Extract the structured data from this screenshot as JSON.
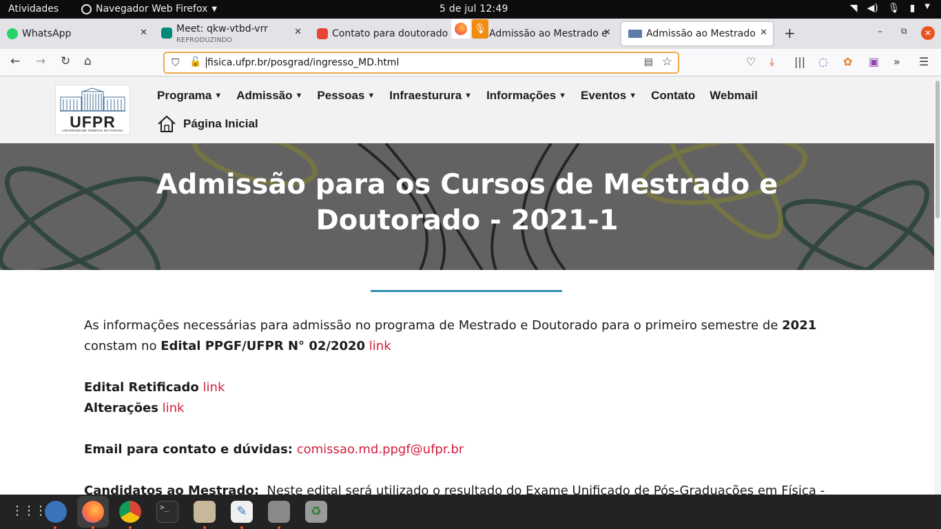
{
  "topbar": {
    "activities": "Atividades",
    "app_name": "Navegador Web Firefox",
    "clock": "5 de jul  12:49"
  },
  "tabs": [
    {
      "label": "WhatsApp",
      "favicon": "whatsapp-icon",
      "color": "#25d366"
    },
    {
      "label": "Meet: qkw-vtbd-vrr",
      "sublabel": "REPRODUZINDO",
      "favicon": "meet-icon",
      "color": "#00897b"
    },
    {
      "label": "Contato para doutorado -",
      "favicon": "gmail-icon",
      "color": "#ea4335"
    },
    {
      "label": "Admissão ao Mestrado e",
      "favicon": "ufpr-icon",
      "color": "#5b7da8"
    },
    {
      "label": "Admissão ao Mestrado e",
      "favicon": "ufpr-icon",
      "color": "#5b7da8",
      "active": true
    }
  ],
  "urlbar": {
    "url": "fisica.ufpr.br/posgrad/ingresso_MD.html"
  },
  "site": {
    "logo": {
      "name": "UFPR",
      "subtitle": "UNIVERSIDADE FEDERAL DO PARANÁ"
    },
    "nav": [
      {
        "label": "Programa",
        "dropdown": true
      },
      {
        "label": "Admissão",
        "dropdown": true
      },
      {
        "label": "Pessoas",
        "dropdown": true
      },
      {
        "label": "Infraesturura",
        "dropdown": true
      },
      {
        "label": "Informações",
        "dropdown": true
      },
      {
        "label": "Eventos",
        "dropdown": true
      },
      {
        "label": "Contato",
        "dropdown": false
      },
      {
        "label": "Webmail",
        "dropdown": false
      }
    ],
    "home_label": "Página Inicial"
  },
  "hero": {
    "title_line1": "Admissão para os Cursos de Mestrado e",
    "title_line2": "Doutorado - 2021-1"
  },
  "content": {
    "intro_a": "As informações necessárias para admissão no programa de Mestrado e Doutorado para o primeiro semestre de ",
    "intro_year": "2021",
    "intro_b": "constam no ",
    "edital_name": "Edital PPGF/UFPR N° 02/2020",
    "link_text": "link",
    "retificado_label": "Edital Retificado",
    "alteracoes_label": "Alterações",
    "email_label": "Email para contato e dúvidas:",
    "email": "comissao.md.ppgf@ufpr.br",
    "mestrado_label": "Candidatos ao Mestrado:",
    "mestrado_text": "Neste edital será utilizado o resultado do Exame Unificado de Pós-Graduações em Física -"
  },
  "colors": {
    "link": "#d31d3d",
    "divider": "#2e8fb4",
    "ubuntu_orange": "#e95420"
  }
}
